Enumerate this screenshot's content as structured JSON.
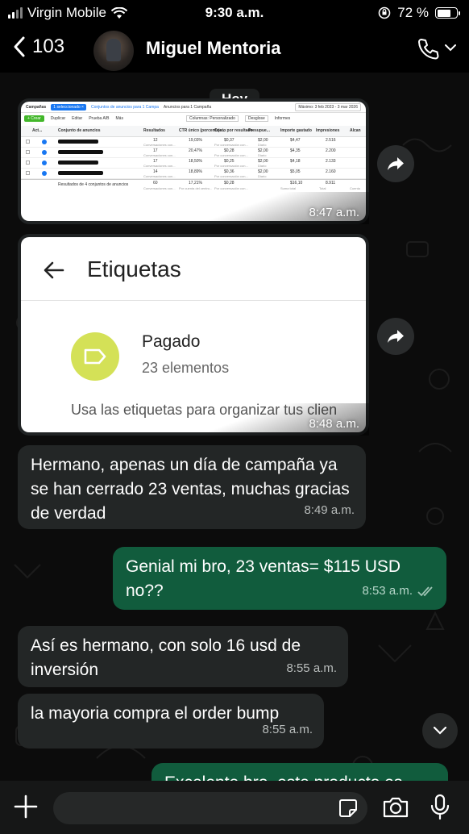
{
  "status_bar": {
    "carrier": "Virgin Mobile",
    "time": "9:30 a.m.",
    "battery": "72 %"
  },
  "header": {
    "back_count": "103",
    "contact_name": "Miguel Mentoria"
  },
  "date_chip": "Hoy",
  "messages": [
    {
      "type": "image",
      "direction": "in",
      "time": "8:47 a.m.",
      "content": {
        "tabs": [
          "Campañas",
          "1 seleccionado ×",
          "Conjuntos de anuncios para 1 Campa",
          "Anuncios para 1 Campaña",
          "Máximo: 3 feb 2023 - 3 mar 2026"
        ],
        "toolbar": [
          "+ Crear",
          "Duplicar",
          "Editar",
          "Prueba A/B",
          "Más",
          "Columnas: Personalizado",
          "Desglose",
          "Informes"
        ],
        "headers": [
          "Act...",
          "Conjunto de anuncios",
          "Resultados",
          "CTR único (porcentaje...",
          "Costo por resultado",
          "Presupue...",
          "Importe gastado",
          "Impresiones",
          "Alcan"
        ],
        "rows": [
          {
            "results": "12",
            "ctr": "19,03%",
            "cost": "$0,37",
            "budget": "$2,00",
            "spent": "$4,47",
            "impressions": "2.516"
          },
          {
            "results": "17",
            "ctr": "20,47%",
            "cost": "$0,28",
            "budget": "$2,00",
            "spent": "$4,35",
            "impressions": "2.200"
          },
          {
            "results": "17",
            "ctr": "18,50%",
            "cost": "$0,25",
            "budget": "$2,00",
            "spent": "$4,18",
            "impressions": "2.133"
          },
          {
            "results": "14",
            "ctr": "18,89%",
            "cost": "$0,36",
            "budget": "$2,00",
            "spent": "$5,05",
            "impressions": "2.160"
          }
        ],
        "row_sub": "Conversaciones con...",
        "row_sub2": "Por conversación con...",
        "row_budget_sub": "Diario",
        "total_label": "Resultados de 4 conjuntos de anuncios",
        "total": {
          "results": "60",
          "ctr": "17,21%",
          "cost": "$0,28",
          "spent": "$16,10",
          "impressions": "8.911",
          "results_sub": "Conversaciones con...",
          "ctr_sub": "Por cuenta del centro...",
          "cost_sub": "Por conversación con...",
          "spent_sub": "Suma total",
          "impressions_sub": "Total",
          "reach_sub": "Cuenta"
        }
      }
    },
    {
      "type": "image",
      "direction": "in",
      "time": "8:48 a.m.",
      "content": {
        "title": "Etiquetas",
        "label_name": "Pagado",
        "label_count": "23 elementos",
        "hint": "Usa las etiquetas para organizar tus clien"
      }
    },
    {
      "type": "text",
      "direction": "in",
      "text": "Hermano, apenas un día de campaña ya se han cerrado 23 ventas, muchas gracias de verdad",
      "time": "8:49 a.m."
    },
    {
      "type": "text",
      "direction": "out",
      "text": "Genial mi bro, 23 ventas= $115 USD no??",
      "time": "8:53 a.m."
    },
    {
      "type": "text",
      "direction": "in",
      "text": "Así es hermano, con solo 16 usd de inversión",
      "time": "8:55 a.m."
    },
    {
      "type": "text",
      "direction": "in",
      "text": "la mayoria compra el order bump",
      "time": "8:55 a.m."
    },
    {
      "type": "text",
      "direction": "out",
      "text": "Excelente bro, este producto es"
    }
  ],
  "colors": {
    "incoming_bubble": "#232626",
    "outgoing_bubble": "#115c3d",
    "background": "#0c0c0c",
    "label_icon": "#d4e157"
  },
  "icons": [
    "wifi-icon",
    "signal-icon",
    "battery-icon",
    "lock-rotation-icon",
    "back-chevron-icon",
    "phone-icon",
    "chevron-down-icon",
    "forward-icon",
    "double-check-icon",
    "plus-icon",
    "sticker-icon",
    "camera-icon",
    "mic-icon",
    "arrow-left-icon",
    "label-icon"
  ]
}
